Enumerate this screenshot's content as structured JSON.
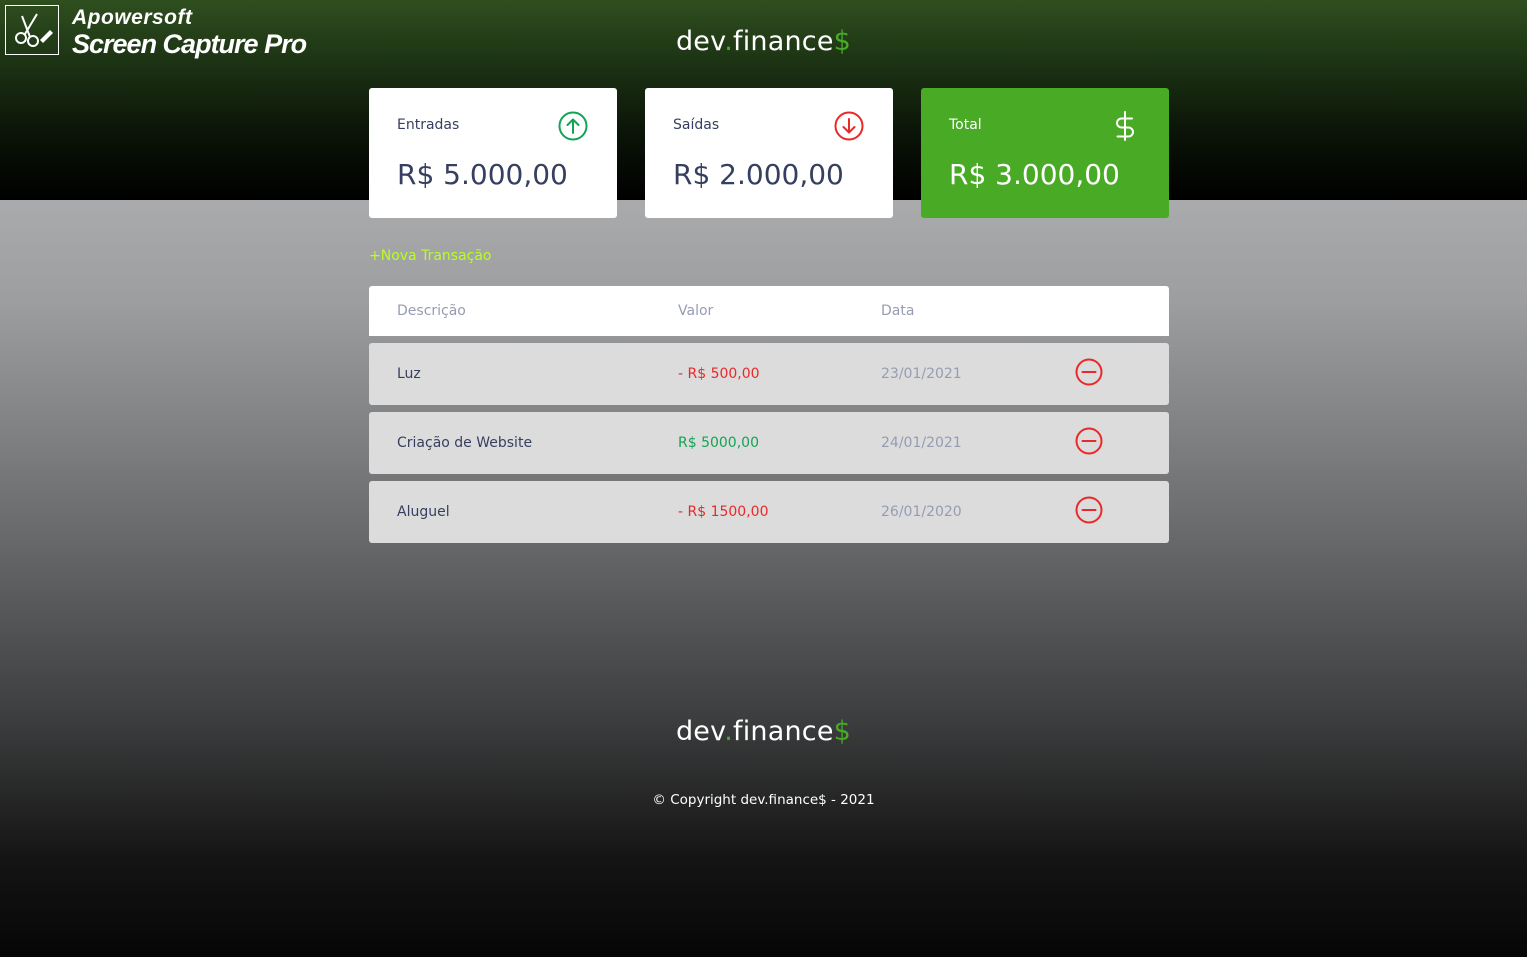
{
  "watermark": {
    "brand": "Apowersoft",
    "product": "Screen Capture Pro"
  },
  "logo": {
    "main": "dev",
    "dot": ".",
    "suffix": "finance",
    "cash": "$"
  },
  "summary": {
    "income": {
      "label": "Entradas",
      "amount": "R$ 5.000,00",
      "icon": "arrow-up-circle-icon",
      "icon_color": "#12a454"
    },
    "expense": {
      "label": "Saídas",
      "amount": "R$ 2.000,00",
      "icon": "arrow-down-circle-icon",
      "icon_color": "#e92929"
    },
    "total": {
      "label": "Total",
      "amount": "R$ 3.000,00",
      "icon": "dollar-sign-icon",
      "background": "#49aa26"
    }
  },
  "new_transaction_label": "+Nova Transação",
  "table": {
    "headers": [
      "Descrição",
      "Valor",
      "Data"
    ],
    "rows": [
      {
        "description": "Luz",
        "amount": "- R$ 500,00",
        "type": "expense",
        "date": "23/01/2021"
      },
      {
        "description": "Criação de Website",
        "amount": "R$ 5000,00",
        "type": "income",
        "date": "24/01/2021"
      },
      {
        "description": "Aluguel",
        "amount": "- R$ 1500,00",
        "type": "expense",
        "date": "26/01/2020"
      }
    ],
    "remove_icon": "minus-circle-icon"
  },
  "footer": {
    "copyright": "© Copyright dev.finance$ - 2021"
  },
  "colors": {
    "accent_green": "#49aa26",
    "income_green": "#12a454",
    "expense_red": "#e92929",
    "new_transaction": "#b8ff20",
    "text_dark": "#363f5f",
    "text_muted": "#969cb3"
  }
}
